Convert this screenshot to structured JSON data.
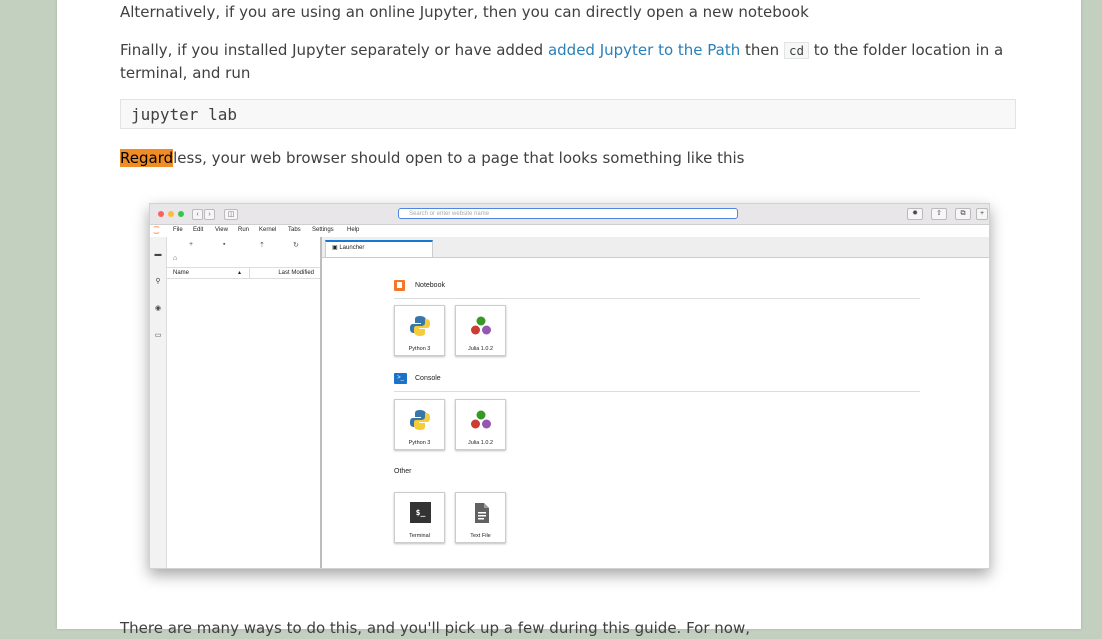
{
  "paragraphs": {
    "p1": "Alternatively, if you are using an online Jupyter, then you can directly open a new notebook",
    "p2_pre": "Finally, if you installed Jupyter separately or have added ",
    "p2_link": "added Jupyter to the Path",
    "p2_mid": " then ",
    "p2_code": "cd",
    "p2_post": " to the folder location in a terminal, and run",
    "code_block": "jupyter lab",
    "p3_highlight": "Regard",
    "p3_rest": "less, your web browser should open to a page that looks something like this",
    "p4": "There are many ways to do this, and you'll pick up a few during this guide. For now,"
  },
  "screenshot": {
    "url_placeholder": "Search or enter website name",
    "menus": [
      "File",
      "Edit",
      "View",
      "Run",
      "Kernel",
      "Tabs",
      "Settings",
      "Help"
    ],
    "file_columns": {
      "name": "Name",
      "modified": "Last Modified"
    },
    "tab_label": "Launcher",
    "sections": {
      "notebook": "Notebook",
      "console": "Console",
      "other": "Other"
    },
    "cards": {
      "nb_python": "Python 3",
      "nb_julia": "Julia 1.0.2",
      "con_python": "Python 3",
      "con_julia": "Julia 1.0.2",
      "terminal": "Terminal",
      "textfile": "Text File"
    },
    "terminal_glyph": "$_",
    "console_glyph": ">_"
  },
  "colors": {
    "link": "#2980b9",
    "highlight": "#f08c26",
    "page_bg": "#c3d0c0",
    "jupyter_orange": "#f37726",
    "console_blue": "#1a73c8"
  }
}
